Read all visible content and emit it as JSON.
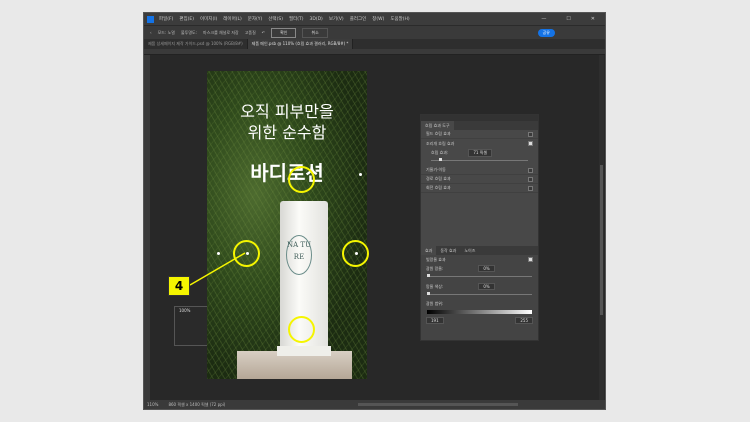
{
  "menu": [
    "파일(F)",
    "편집(E)",
    "이미지(I)",
    "레이어(L)",
    "문자(Y)",
    "선택(S)",
    "필터(T)",
    "3D(D)",
    "보기(V)",
    "플러그인",
    "창(W)",
    "도움말(H)"
  ],
  "window_controls": [
    "—",
    "☐",
    "✕"
  ],
  "options": {
    "mode": "모드: 노멀",
    "opacity_label": "불투명도:",
    "opacity": "100%",
    "mask_label": "마스크를 채널로 저장",
    "highquality": "고품질",
    "ok": "확인",
    "cancel": "취소",
    "share": "공유"
  },
  "tabs": [
    "제품 상세페이지 제작 가이드.psd @ 100% (RGB/8#)",
    "제품 메인.psb @ 110% (흐림 효과 갤러리, RGB/8#) *"
  ],
  "status": {
    "zoom": "110%",
    "doc": "860 픽셀 x 1400 픽셀 (72 ppi)"
  },
  "canvas": {
    "headline": [
      "오직 피부만을",
      "위한 순수함"
    ],
    "product": "바디로션",
    "label": "NA TU RE"
  },
  "panel": {
    "title": "흐림 효과 도구",
    "items": [
      {
        "label": "필드 흐림 효과",
        "on": false
      },
      {
        "label": "조리개 흐림 효과",
        "on": true
      },
      {
        "label": "기울기-이동",
        "on": false
      },
      {
        "label": "경로 흐림 효과",
        "on": false
      },
      {
        "label": "회전 흐림 효과",
        "on": false
      }
    ],
    "blur_label": "흐림 효과:",
    "blur_value": "71 픽셀",
    "lower_tabs": [
      "효과",
      "동작 효과",
      "노이즈"
    ],
    "bokeh_label": "빛망울 효과",
    "light_bokeh_label": "광원 망울:",
    "light_bokeh": "0%",
    "bokeh_color_label": "망울 색상:",
    "bokeh_color": "0%",
    "light_range_label": "광원 범위:",
    "range_low": "191",
    "range_high": "255"
  },
  "callout": "4",
  "colors": {
    "highlight": "#f5f500",
    "accent": "#1473e6"
  }
}
